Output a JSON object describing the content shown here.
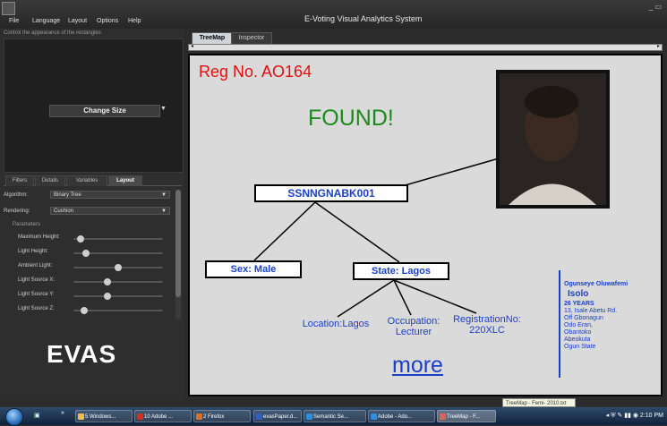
{
  "window": {
    "title": "E-Voting Visual Analytics System"
  },
  "menu": [
    "File",
    "Language",
    "Layout",
    "Options",
    "Help"
  ],
  "left_panel": {
    "hint": "Control the appearance of the rectangles",
    "change_size": "Change Size",
    "tabs": [
      "Filters",
      "Details",
      "Variables",
      "Layout"
    ],
    "active_tab": "Layout",
    "algorithm_label": "Algorithm:",
    "algorithm_value": "Binary Tree",
    "rendering_label": "Rendering:",
    "rendering_value": "Cushion",
    "params_label": "Parameters",
    "sliders": [
      {
        "label": "Maximum Height:",
        "value": 0.08
      },
      {
        "label": "Light Height:",
        "value": 0.14
      },
      {
        "label": "Ambient Light:",
        "value": 0.5
      },
      {
        "label": "Light Source X:",
        "value": 0.38
      },
      {
        "label": "Light Source Y:",
        "value": 0.38
      },
      {
        "label": "Light Source Z:",
        "value": 0.12
      }
    ],
    "logo": "EVAS"
  },
  "main_tabs": [
    "TreeMap",
    "Inspector"
  ],
  "active_main_tab": "TreeMap",
  "canvas": {
    "reg_no": "Reg No. AO164",
    "status": "FOUND!",
    "root": "SSNNGNABK001",
    "sex": "Sex: Male",
    "state": "State: Lagos",
    "leaves": {
      "location": "Location:Lagos",
      "occupation_1": "Occupation:",
      "occupation_2": "Lecturer",
      "registration_1": "RegistrationNo:",
      "registration_2": "220XLC"
    },
    "more": "more",
    "person": {
      "name": "Ogunseye Oluwafemi",
      "city": "Isolo",
      "age": "26 YEARS",
      "address": [
        "13, Isale Abetu Rd.",
        "Off Gbonagun",
        "Odo Eran,",
        "Obantoko",
        "Abeokuta",
        "Ogun State"
      ]
    },
    "colors": {
      "reg": "#e01010",
      "found": "#1a8a1a",
      "node_text": "#1a3fc8"
    }
  },
  "tooltip": "TreeMap - Femi- 2010.txt",
  "taskbar": {
    "items": [
      {
        "label": "5 Windows...",
        "color": "#e8c050"
      },
      {
        "label": "10 Adobe ...",
        "color": "#d03020"
      },
      {
        "label": "2 Firefox",
        "color": "#e07020"
      },
      {
        "label": "evasPaper.d...",
        "color": "#3060c0"
      },
      {
        "label": "Semantic Se...",
        "color": "#3090e0"
      },
      {
        "label": "Adobe - Ado...",
        "color": "#3090e0"
      },
      {
        "label": "TreeMap - F...",
        "color": "#e06060"
      }
    ],
    "active_item": "TreeMap - F...",
    "clock": "2:10 PM"
  }
}
